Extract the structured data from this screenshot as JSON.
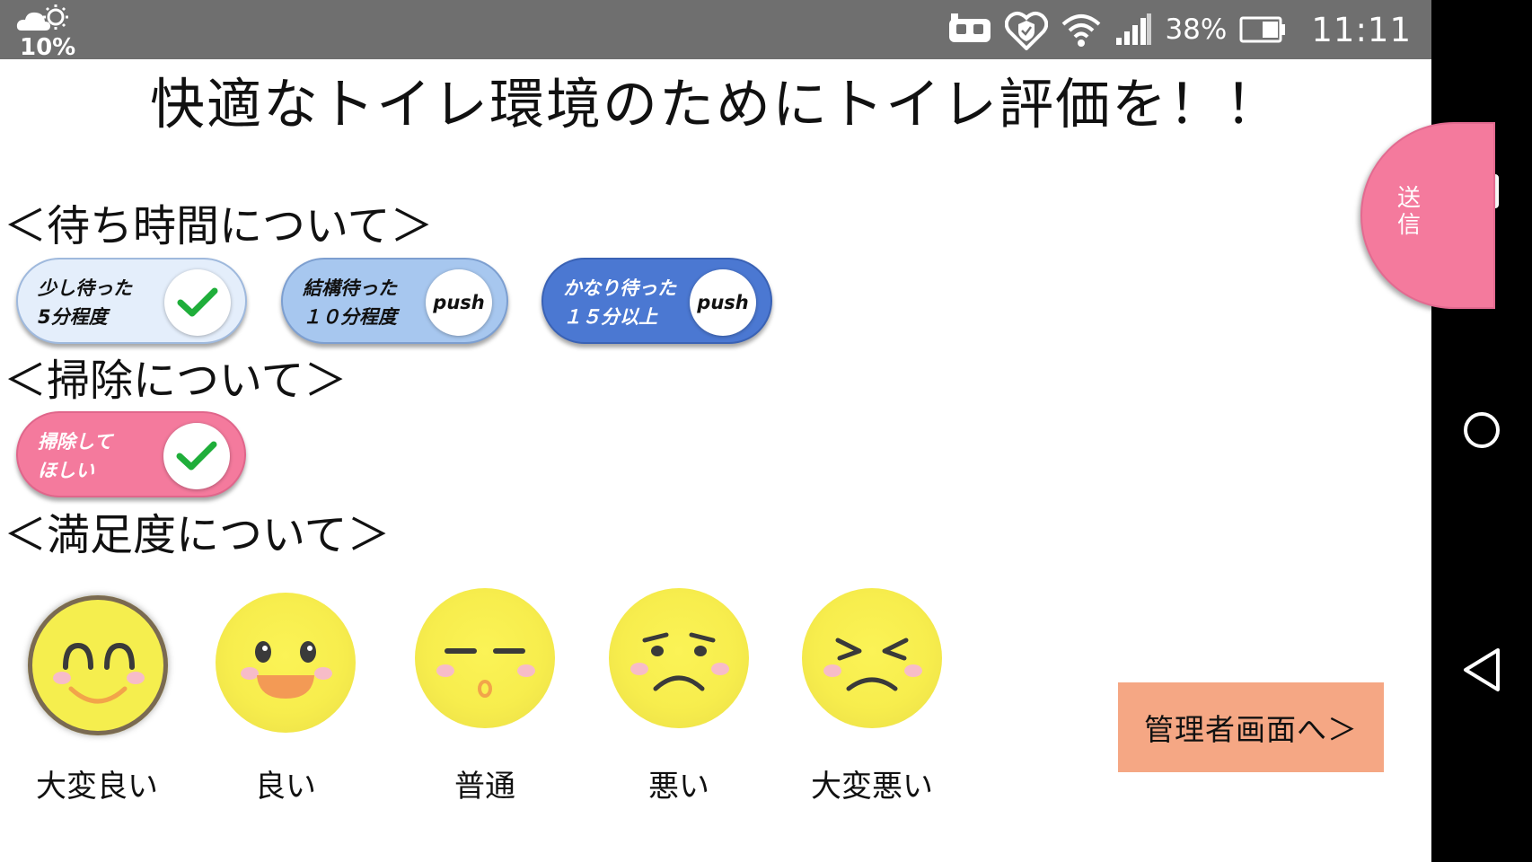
{
  "status_bar": {
    "temperature": "10%",
    "battery_percent": "38%",
    "time": "11:11"
  },
  "title": "快適なトイレ環境のためにトイレ評価を！！",
  "sections": {
    "wait": {
      "heading": "＜待ち時間について＞",
      "options": [
        {
          "label": "少し待った\n5分程度",
          "state": "checked",
          "knob_text": ""
        },
        {
          "label": "結構待った\n１０分程度",
          "state": "push",
          "knob_text": "push"
        },
        {
          "label": "かなり待った\n１５分以上",
          "state": "push",
          "knob_text": "push"
        }
      ]
    },
    "cleaning": {
      "heading": "＜掃除について＞",
      "options": [
        {
          "label": "掃除して\nほしい",
          "state": "checked"
        }
      ]
    },
    "satisfaction": {
      "heading": "＜満足度について＞",
      "options": [
        {
          "label": "大変良い",
          "selected": true
        },
        {
          "label": "良い",
          "selected": false
        },
        {
          "label": "普通",
          "selected": false
        },
        {
          "label": "悪い",
          "selected": false
        },
        {
          "label": "大変悪い",
          "selected": false
        }
      ]
    }
  },
  "send_button": {
    "label": "送信"
  },
  "admin_button": {
    "label": "管理者画面へ＞"
  },
  "colors": {
    "status_bar": "#6f6f6f",
    "nav_bar": "#000000",
    "pink": "#f47a9d",
    "blue_dark": "#4b78d2",
    "blue_mid": "#a7c7ef",
    "blue_light": "#e4eefb",
    "face_yellow": "#f7ed4d",
    "admin_button": "#f5a784",
    "check_green": "#1fae3a"
  },
  "icons": {
    "status_left": [
      "weather-cloudy-sun-icon"
    ],
    "status_right": [
      "vr-headset-icon",
      "heart-shield-icon",
      "wifi-icon",
      "signal-icon",
      "battery-icon"
    ],
    "nav": [
      "recents-square-icon",
      "home-circle-icon",
      "back-triangle-icon"
    ]
  }
}
